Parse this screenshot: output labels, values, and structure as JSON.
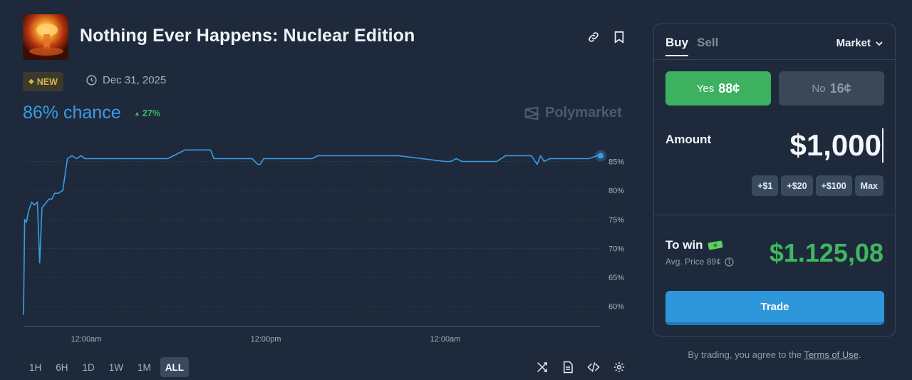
{
  "market": {
    "title": "Nothing Ever Happens: Nuclear Edition",
    "image_icon": "nuclear-explosion-image",
    "badge": "NEW",
    "end_date": "Dec 31, 2025",
    "chance": "86% chance",
    "change": "27%",
    "watermark": "Polymarket"
  },
  "header_actions": {
    "link_icon": "link-icon",
    "bookmark_icon": "bookmark-icon"
  },
  "chart_data": {
    "type": "line",
    "title": "",
    "xlabel": "",
    "ylabel": "",
    "x_tick_labels": [
      "12:00am",
      "12:00pm",
      "12:00am"
    ],
    "y_tick_labels": [
      "85%",
      "80%",
      "75%",
      "70%",
      "65%",
      "60%"
    ],
    "y_ticks": [
      85,
      80,
      75,
      70,
      65,
      60
    ],
    "ylim": [
      56.5,
      89.5
    ],
    "xlim": [
      0,
      100
    ],
    "grid": "dotted-horizontal",
    "color": "#3a9ce4",
    "series": [
      {
        "x": [
          0,
          0.2,
          0.5,
          0.9,
          1.4,
          1.9,
          2.4,
          2.8,
          3.2,
          3.6,
          4.0,
          4.4,
          4.9,
          5.4,
          6.0,
          6.8,
          7.6,
          8.4,
          9.2,
          10.0,
          10.6,
          11.0,
          11.5,
          12.0,
          12.6,
          13.6,
          14.6,
          15.2,
          15.8,
          16.4,
          17.6,
          19.2,
          21.0,
          25.0,
          26.0,
          28.0,
          28.6,
          29.2,
          30.2,
          32.4,
          33.0,
          37.0,
          39.6,
          40.6,
          41.0,
          41.6,
          44.0,
          50.0,
          51.0,
          56.0,
          57.0,
          58.0,
          63.0,
          64.6,
          65.0,
          73.0,
          74.0,
          75.0,
          76.0,
          80.0,
          82.0,
          83.5,
          84.8,
          86.0,
          88.0,
          89.0,
          89.6,
          90.2,
          91.2,
          92.0,
          93.0,
          98.0,
          99.4,
          100.0
        ],
        "values": [
          58.5,
          75.0,
          74.5,
          76.5,
          78.0,
          77.5,
          78.0,
          67.5,
          77.0,
          77.5,
          78.0,
          78.5,
          78.5,
          79.5,
          79.5,
          80.0,
          85.5,
          86.0,
          85.5,
          86.0,
          85.5,
          85.5,
          85.5,
          85.5,
          85.5,
          85.5,
          85.5,
          85.5,
          85.5,
          85.5,
          85.5,
          85.5,
          85.5,
          85.5,
          86.0,
          87.0,
          87.0,
          87.0,
          87.0,
          87.0,
          85.5,
          85.5,
          85.5,
          84.5,
          84.5,
          85.5,
          85.5,
          85.5,
          86.0,
          86.0,
          86.0,
          86.0,
          86.0,
          86.0,
          86.0,
          85.0,
          85.0,
          85.5,
          85.0,
          85.0,
          85.0,
          86.0,
          86.0,
          86.0,
          86.0,
          84.5,
          86.0,
          85.0,
          85.5,
          85.5,
          85.5,
          85.5,
          86.0,
          86.0
        ]
      }
    ]
  },
  "time_ranges": [
    "1H",
    "6H",
    "1D",
    "1W",
    "1M",
    "ALL"
  ],
  "time_range_active": "ALL",
  "chart_tools": [
    "shuffle-icon",
    "document-icon",
    "code-icon",
    "settings-icon"
  ],
  "trade_panel": {
    "tabs": {
      "buy": "Buy",
      "sell": "Sell"
    },
    "order_type": "Market",
    "yes_label": "Yes",
    "yes_price": "88¢",
    "no_label": "No",
    "no_price": "16¢",
    "amount_label": "Amount",
    "amount_value": "$1,000",
    "quick_amounts": [
      "+$1",
      "+$20",
      "+$100",
      "Max"
    ],
    "to_win_label": "To win",
    "to_win_icon": "money-icon",
    "avg_price": "Avg. Price 89¢",
    "to_win_value": "$1.125,08",
    "trade_button": "Trade"
  },
  "terms": {
    "prefix": "By trading, you agree to the ",
    "link": "Terms of Use",
    "suffix": "."
  },
  "colors": {
    "background": "#1e2a3b",
    "accent_blue": "#3a9ce4",
    "green": "#3db15f",
    "new_badge": "#d9b44a"
  }
}
